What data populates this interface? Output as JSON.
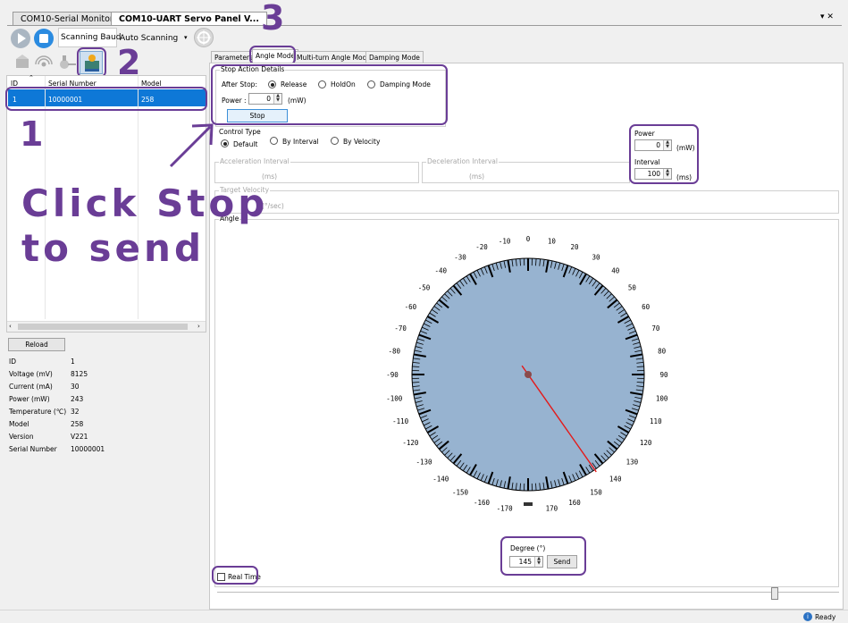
{
  "window": {
    "tabs": [
      "COM10-Serial Monitor",
      "COM10-UART Servo Panel V..."
    ],
    "active_tab": 1,
    "close_glyph": "▾ ✕"
  },
  "toolbar": {
    "baud_label": "Scanning Baud",
    "baud_value": "Auto Scanning",
    "icons": [
      "play-icon",
      "stop-icon",
      "target-icon"
    ]
  },
  "device_toolbar": {
    "icons": [
      "servo-grey-icon",
      "wireless-icon",
      "probe-icon",
      "servo-panel-icon"
    ]
  },
  "device_table": {
    "columns": [
      "ID",
      "Serial Number",
      "Model"
    ],
    "rows": [
      [
        "1",
        "10000001",
        "258"
      ]
    ]
  },
  "reload_label": "Reload",
  "device_info": [
    [
      "ID",
      "1"
    ],
    [
      "Voltage (mV)",
      "8125"
    ],
    [
      "Current (mA)",
      "30"
    ],
    [
      "Power (mW)",
      "243"
    ],
    [
      "Temperature (℃)",
      "32"
    ],
    [
      "Model",
      "258"
    ],
    [
      "Version",
      "V221"
    ],
    [
      "Serial Number",
      "10000001"
    ]
  ],
  "mode_tabs": [
    "Parameters",
    "Angle Mode",
    "Multi-turn Angle Mode",
    "Damping Mode"
  ],
  "active_mode_tab": 1,
  "stop_action": {
    "title": "Stop Action Details",
    "after_stop_label": "After Stop:",
    "options": [
      "Release",
      "HoldOn",
      "Damping Mode"
    ],
    "selected": "Release",
    "power_label": "Power :",
    "power_value": "0",
    "power_unit": "(mW)",
    "stop_button": "Stop"
  },
  "control_type": {
    "title": "Control Type",
    "options": [
      "Default",
      "By Interval",
      "By Velocity"
    ],
    "selected": "Default"
  },
  "power_box": {
    "title": "Power",
    "value": "0",
    "unit": "(mW)"
  },
  "interval_box": {
    "title": "Interval",
    "value": "100",
    "unit": "(ms)"
  },
  "acceleration": {
    "title": "Acceleration Interval",
    "unit": "(ms)"
  },
  "deceleration": {
    "title": "Deceleration Interval",
    "unit": "(ms)"
  },
  "target_velocity": {
    "title": "Target Velocity",
    "unit": "(°/sec)"
  },
  "angle_group": {
    "title": "Angle"
  },
  "dial": {
    "labels": [
      "-170",
      "-160",
      "-150",
      "-140",
      "-130",
      "-120",
      "-110",
      "-100",
      "-90",
      "-80",
      "-70",
      "-60",
      "-50",
      "-40",
      "-30",
      "-20",
      "-10",
      "0",
      "10",
      "20",
      "30",
      "40",
      "50",
      "60",
      "70",
      "80",
      "90",
      "100",
      "110",
      "120",
      "130",
      "140",
      "150",
      "160",
      "170"
    ],
    "needle_angle": 145,
    "face_color": "#97b3d0",
    "needle_color": "#e31b1b"
  },
  "degree": {
    "label": "Degree (°)",
    "value": "145",
    "send_button": "Send"
  },
  "real_time_label": "Real Time",
  "status": {
    "text": "Ready"
  },
  "annotations": {
    "step1": "1",
    "step2": "2",
    "step3": "3",
    "instruction_line1": "Click Stop",
    "instruction_line2": "to send",
    "color": "#6a3d96"
  }
}
